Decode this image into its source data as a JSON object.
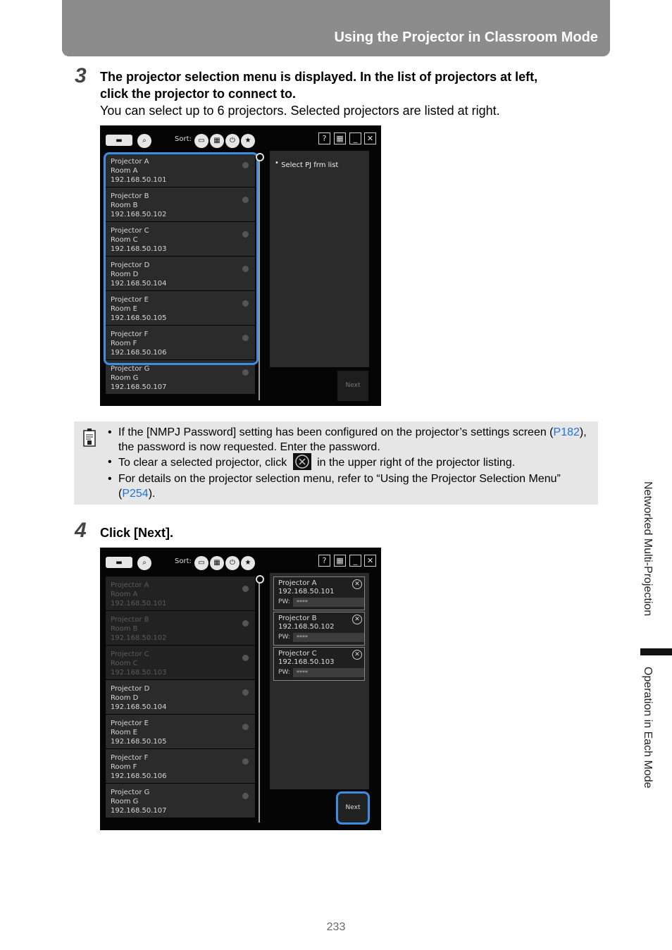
{
  "header": {
    "title": "Using the Projector in Classroom Mode"
  },
  "step3": {
    "number": "3",
    "line1": "The projector selection menu is displayed. In the list of projectors at left,",
    "line2": "click the projector to connect to.",
    "line3": "You can select up to 6 projectors. Selected projectors are listed at right."
  },
  "step4": {
    "number": "4",
    "text": "Click [Next]."
  },
  "app": {
    "sort_label": "Sort:",
    "help": "?",
    "close": "✕",
    "minimize": "_",
    "next_label": "Next",
    "placeholder": "Select PJ frm list"
  },
  "projectors": [
    {
      "name": "Projector A",
      "room": "Room A",
      "ip": "192.168.50.101"
    },
    {
      "name": "Projector B",
      "room": "Room B",
      "ip": "192.168.50.102"
    },
    {
      "name": "Projector C",
      "room": "Room C",
      "ip": "192.168.50.103"
    },
    {
      "name": "Projector D",
      "room": "Room D",
      "ip": "192.168.50.104"
    },
    {
      "name": "Projector E",
      "room": "Room E",
      "ip": "192.168.50.105"
    },
    {
      "name": "Projector F",
      "room": "Room F",
      "ip": "192.168.50.106"
    },
    {
      "name": "Projector G",
      "room": "Room G",
      "ip": "192.168.50.107"
    }
  ],
  "selected": [
    {
      "name": "Projector A",
      "ip": "192.168.50.101",
      "pw_label": "PW:",
      "pw": "****"
    },
    {
      "name": "Projector B",
      "ip": "192.168.50.102",
      "pw_label": "PW:",
      "pw": "****"
    },
    {
      "name": "Projector C",
      "ip": "192.168.50.103",
      "pw_label": "PW:",
      "pw": "****"
    }
  ],
  "note": {
    "b1_a": "If the [NMPJ Password] setting has been configured on the projector’s settings screen (",
    "b1_link": "P182",
    "b1_b": "), the password is now requested. Enter the password.",
    "b2_a": "To clear a selected projector, click",
    "b2_b": "in the upper right of the projector listing.",
    "b3_a": "For details on the projector selection menu, refer to “Using the Projector Selection Menu” (",
    "b3_link": "P254",
    "b3_b": ")."
  },
  "side": {
    "section": "Networked Multi-Projection",
    "subsection": "Operation in Each Mode"
  },
  "page_number": "233"
}
